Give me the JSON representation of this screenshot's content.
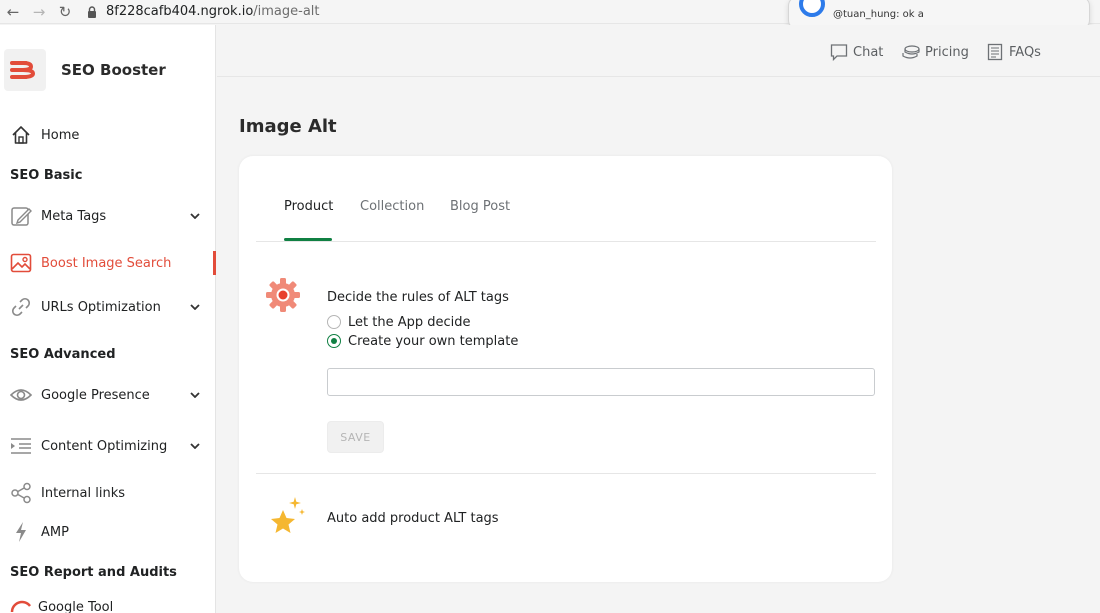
{
  "browser": {
    "url_host": "8f228cafb404.ngrok.io",
    "url_path": "/image-alt"
  },
  "notification": {
    "text": "@tuan_hung: ok a"
  },
  "app": {
    "name": "SEO Booster",
    "accent": "#e24c3a",
    "tab_accent": "#108043"
  },
  "sidebar": {
    "home": "Home",
    "section_basic": "SEO Basic",
    "meta_tags": "Meta Tags",
    "boost_image_search": "Boost Image Search",
    "urls_optimization": "URLs Optimization",
    "section_advanced": "SEO Advanced",
    "google_presence": "Google Presence",
    "content_optimizing": "Content Optimizing",
    "internal_links": "Internal links",
    "amp": "AMP",
    "section_report": "SEO Report and Audits",
    "google_tool": "Google Tool"
  },
  "topnav": {
    "chat": "Chat",
    "pricing": "Pricing",
    "faqs": "FAQs"
  },
  "main": {
    "title": "Image Alt",
    "tabs": [
      {
        "label": "Product",
        "active": true
      },
      {
        "label": "Collection",
        "active": false
      },
      {
        "label": "Blog Post",
        "active": false
      }
    ],
    "rules_title": "Decide the rules of ALT tags",
    "option_app": "Let the App decide",
    "option_template": "Create your own template",
    "selected_option": "Create your own template",
    "template_value": "",
    "save_label": "SAVE",
    "auto_title": "Auto add product ALT tags"
  }
}
